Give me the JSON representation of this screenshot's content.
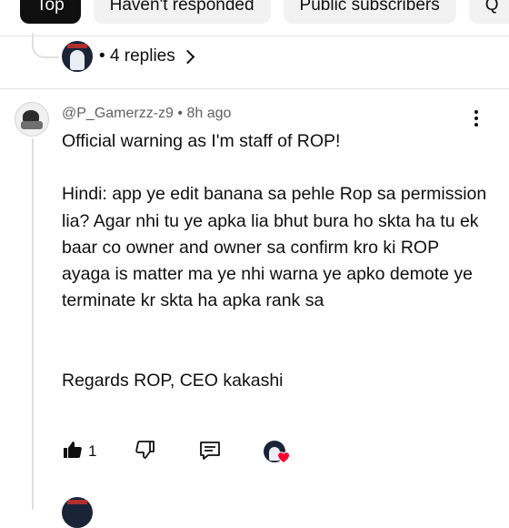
{
  "filters": [
    {
      "label": "Top",
      "active": true
    },
    {
      "label": "Haven't responded",
      "active": false
    },
    {
      "label": "Public subscribers",
      "active": false
    },
    {
      "label": "Q",
      "active": false
    }
  ],
  "previous_thread": {
    "replies_label": "4 replies"
  },
  "comment": {
    "author": "@P_Gamerzz-z9",
    "separator": "•",
    "time": "8h ago",
    "text": "Official warning as I'm staff of ROP!\n\nHindi: app ye edit banana sa pehle Rop sa permission lia? Agar nhi tu ye apka lia bhut bura ho skta ha tu ek baar co owner and owner sa confirm kro ki ROP ayaga is matter ma ye nhi warna ye apko demote ye terminate kr skta ha apka rank sa\n\n\nRegards ROP, CEO kakashi",
    "like_count": "1"
  },
  "colors": {
    "heart": "#ff0033",
    "text": "#0f0f0f",
    "meta": "#606060"
  }
}
